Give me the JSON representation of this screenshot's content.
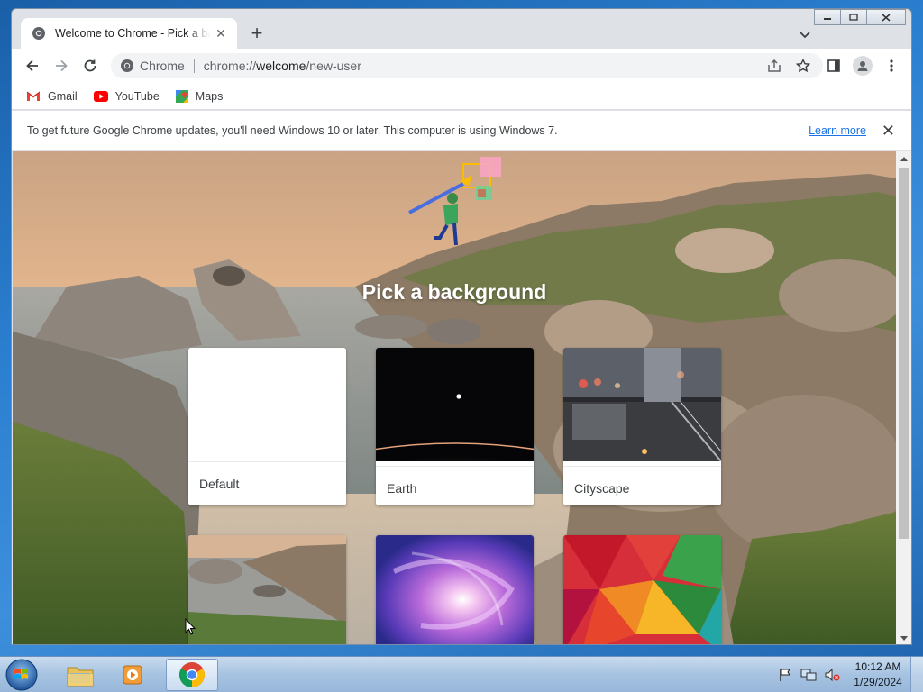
{
  "browser": {
    "tab_title": "Welcome to Chrome - Pick a background",
    "new_tab_label": "+",
    "omnibox": {
      "site_label": "Chrome",
      "url_prefix": "chrome://",
      "url_host": "welcome",
      "url_path": "/new-user"
    },
    "bookmarks": [
      {
        "label": "Gmail",
        "icon": "gmail-icon"
      },
      {
        "label": "YouTube",
        "icon": "youtube-icon"
      },
      {
        "label": "Maps",
        "icon": "maps-icon"
      }
    ]
  },
  "infobar": {
    "message": "To get future Google Chrome updates, you'll need Windows 10 or later. This computer is using Windows 7.",
    "learn_more": "Learn more",
    "close": "✕"
  },
  "page": {
    "heading": "Pick a background",
    "cards": [
      {
        "label": "Default"
      },
      {
        "label": "Earth"
      },
      {
        "label": "Cityscape"
      },
      {
        "label": ""
      },
      {
        "label": ""
      },
      {
        "label": ""
      }
    ]
  },
  "taskbar": {
    "time": "10:12 AM",
    "date": "1/29/2024"
  },
  "colors": {
    "accent": "#1a73e8",
    "tab_strip": "#dee1e6"
  }
}
